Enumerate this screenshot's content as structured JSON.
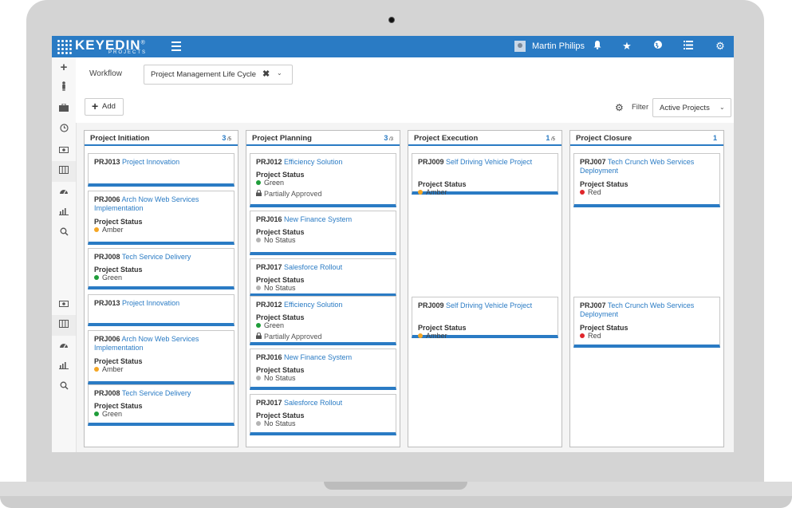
{
  "app": {
    "logo_text": "KEYEDIN",
    "logo_registered": "®",
    "logo_sub": "PROJECTS",
    "user_name": "Martin Philips",
    "topbar_icons": [
      "bell-icon",
      "star-icon",
      "globe-icon",
      "list-icon",
      "settings-icon"
    ],
    "brand_color": "#2a7bc4"
  },
  "left_nav": [
    "plus-icon",
    "person-icon",
    "briefcase-icon",
    "clock-icon",
    "money-icon",
    "board-icon",
    "dashboard-icon",
    "chart-icon",
    "search-icon",
    "money-icon",
    "board-icon",
    "dashboard-icon",
    "chart-icon",
    "search-icon"
  ],
  "workflow": {
    "label": "Workflow",
    "value": "Project Management Life Cycle",
    "clear": "✖",
    "chevron": "⌄"
  },
  "toolbar": {
    "add_label": "Add",
    "add_icon": "+",
    "filter_label": "Filter",
    "filter_value": "Active Projects",
    "filter_chevron": "⌄"
  },
  "status_colors": {
    "Green": "#1f9d3a",
    "Amber": "#f5a623",
    "Red": "#e0262b",
    "No Status": "#b4b4b4"
  },
  "columns": [
    {
      "title": "Project Initiation",
      "count": "3",
      "count_total": "/5",
      "cards": [
        {
          "id": "PRJ013",
          "name": "Project Innovation",
          "status_label": "",
          "status": ""
        },
        {
          "id": "PRJ006",
          "name": "Arch Now Web Services Implementation",
          "status_label": "Project Status",
          "status": "Amber"
        },
        {
          "id": "PRJ008",
          "name": "Tech Service Delivery",
          "status_label": "Project Status",
          "status": "Green"
        },
        {
          "id": "PRJ013",
          "name": "Project Innovation",
          "status_label": "",
          "status": ""
        },
        {
          "id": "PRJ006",
          "name": "Arch Now Web Services Implementation",
          "status_label": "Project Status",
          "status": "Amber"
        },
        {
          "id": "PRJ008",
          "name": "Tech Service Delivery",
          "status_label": "Project Status",
          "status": "Green"
        }
      ]
    },
    {
      "title": "Project Planning",
      "count": "3",
      "count_total": "/3",
      "cards": [
        {
          "id": "PRJ012",
          "name": "Efficiency Solution",
          "status_label": "Project Status",
          "status": "Green",
          "extra": "Partially Approved"
        },
        {
          "id": "PRJ016",
          "name": "New Finance System",
          "status_label": "Project Status",
          "status": "No Status"
        },
        {
          "id": "PRJ017",
          "name": "Salesforce Rollout",
          "status_label": "Project Status",
          "status": "No Status"
        },
        {
          "id": "PRJ012",
          "name": "Efficiency Solution",
          "status_label": "Project Status",
          "status": "Green",
          "extra": "Partially Approved"
        },
        {
          "id": "PRJ016",
          "name": "New Finance System",
          "status_label": "Project Status",
          "status": "No Status"
        },
        {
          "id": "PRJ017",
          "name": "Salesforce Rollout",
          "status_label": "Project Status",
          "status": "No Status"
        }
      ]
    },
    {
      "title": "Project Execution",
      "count": "1",
      "count_total": "/5",
      "cards": [
        {
          "id": "PRJ009",
          "name": "Self Driving Vehicle Project",
          "status_label": "Project Status",
          "status": "Amber"
        },
        {
          "id": "PRJ009",
          "name": "Self Driving Vehicle Project",
          "status_label": "Project Status",
          "status": "Amber"
        }
      ]
    },
    {
      "title": "Project Closure",
      "count": "1",
      "count_total": "",
      "cards": [
        {
          "id": "PRJ007",
          "name": "Tech Crunch Web Services Deployment",
          "status_label": "Project Status",
          "status": "Red"
        },
        {
          "id": "PRJ007",
          "name": "Tech Crunch Web Services Deployment",
          "status_label": "Project Status",
          "status": "Red"
        }
      ]
    }
  ]
}
